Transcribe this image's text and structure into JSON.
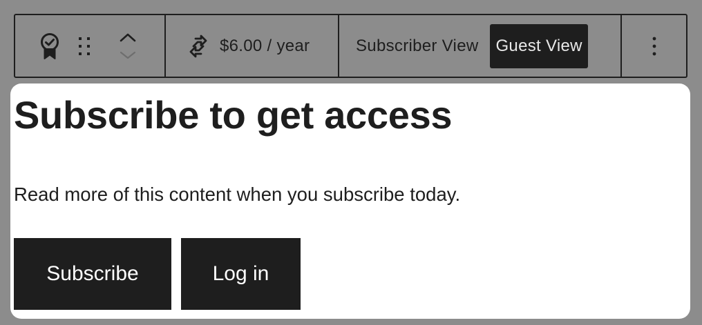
{
  "toolbar": {
    "icons": {
      "block": "award-badge-icon",
      "drag": "drag-handle-icon",
      "move_up": "chevron-up-icon",
      "move_down": "chevron-down-icon",
      "price": "recurring-arrows-icon",
      "more": "more-vertical-icon"
    },
    "price_label": "$6.00 / year",
    "views": {
      "subscriber_label": "Subscriber View",
      "guest_label": "Guest View",
      "active": "Guest View"
    }
  },
  "card": {
    "heading": "Subscribe to get access",
    "description": "Read more of this content when you subscribe today.",
    "subscribe_label": "Subscribe",
    "login_label": "Log in"
  },
  "colors": {
    "backdrop": "#8c8c8c",
    "toolbar_text": "#1e1e1e",
    "active_view_bg": "#1e1e1e",
    "button_bg": "#1e1e1e",
    "button_text": "#ffffff",
    "card_bg": "#ffffff",
    "disabled_icon": "#6e6e6e"
  }
}
